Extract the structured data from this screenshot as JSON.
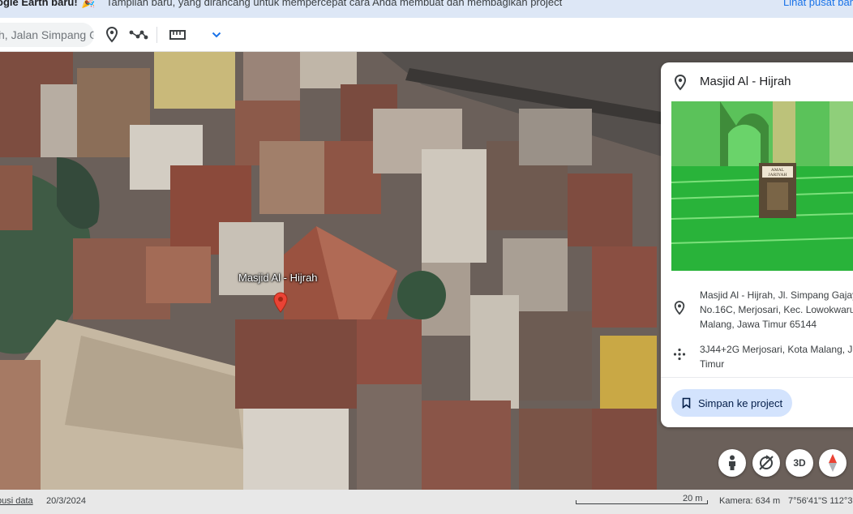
{
  "banner": {
    "title": "ogle Earth baru!",
    "message": "Tampilan baru, yang dirancang untuk mempercepat cara Anda membuat dan membagikan project",
    "link": "Lihat pusat bant"
  },
  "toolbar": {
    "search_value": "h, Jalan Simpang G",
    "icons": [
      "place-marker-icon",
      "path-icon",
      "ruler-icon",
      "chevron-down-icon"
    ]
  },
  "map": {
    "place_label": "Masjid Al - Hijrah"
  },
  "card": {
    "title": "Masjid Al - Hijrah",
    "address_lines": [
      "Masjid Al - Hijrah, Jl. Simpang Gajay",
      "No.16C, Merjosari, Kec. Lowokwaru",
      "Malang, Jawa Timur 65144"
    ],
    "plus_code_lines": [
      "3J44+2G Merjosari, Kota Malang, J",
      "Timur"
    ],
    "save_button": "Simpan ke project",
    "photo_sign_line1": "AMAL",
    "photo_sign_line2": "JARIYAH"
  },
  "controls": {
    "threed_label": "3D"
  },
  "status": {
    "data_source": "busi data",
    "date": "20/3/2024",
    "scale": "20 m",
    "camera": "Kamera: 634 m",
    "coordinates": "7°56'41\"S 112°3"
  },
  "colors": {
    "accent": "#1a73e8",
    "pin": "#ea4335",
    "banner_bg": "#dde7f6",
    "save_bg": "#d3e3fd"
  }
}
